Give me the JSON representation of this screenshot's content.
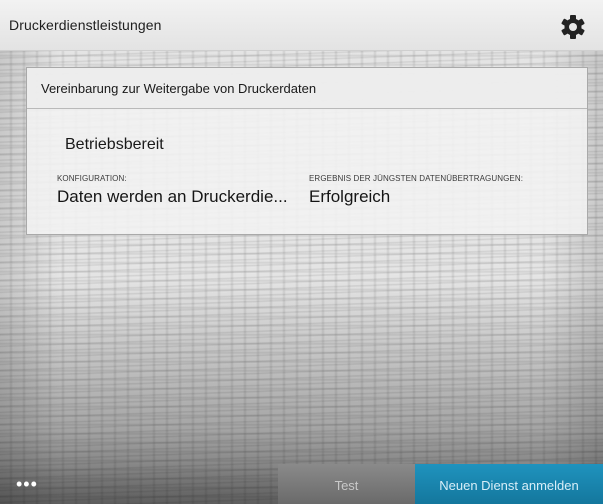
{
  "header": {
    "title": "Druckerdienstleistungen",
    "settings_icon": "gear-icon"
  },
  "card": {
    "title": "Vereinbarung zur Weitergabe von Druckerdaten",
    "status": "Betriebsbereit",
    "config_label": "KONFIGURATION:",
    "config_value": "Daten werden an Druckerdie...",
    "result_label": "ERGEBNIS DER JÜNGSTEN DATENÜBERTRAGUNGEN:",
    "result_value": "Erfolgreich"
  },
  "footer": {
    "more_label": "•••",
    "test_label": "Test",
    "new_service_label": "Neuen Dienst anmelden"
  },
  "colors": {
    "accent": "#1a88b3",
    "disabled_button": "#7a7a7a"
  }
}
